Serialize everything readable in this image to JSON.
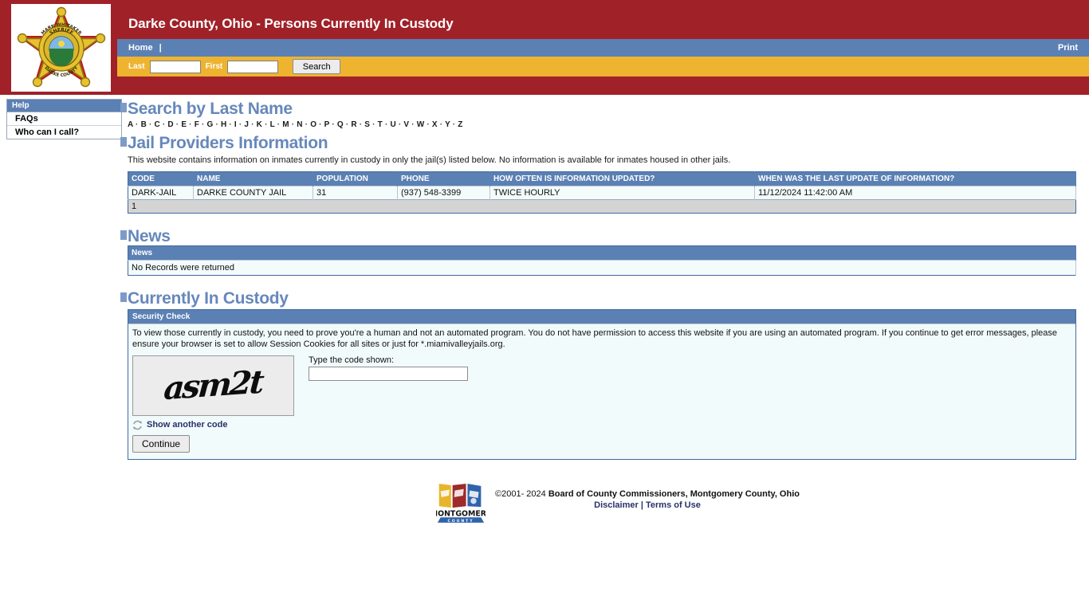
{
  "header": {
    "site_title": "Darke County, Ohio - Persons Currently In Custody",
    "logo_alt": "Mark Whitaker Sheriff Darke County badge",
    "badge_top_text": "MARK WHITAKER",
    "badge_mid_text": "SHERIFF",
    "badge_bottom_text": "DARKE COUNTY",
    "nav": {
      "home_label": "Home",
      "separator": "|",
      "print_label": "Print"
    },
    "search": {
      "last_label": "Last",
      "last_value": "",
      "last_placeholder": "",
      "first_label": "First",
      "first_value": "",
      "first_placeholder": "",
      "search_button": "Search"
    }
  },
  "sidebar": {
    "header": "Help",
    "items": [
      {
        "label": "FAQs"
      },
      {
        "label": "Who can I call?"
      }
    ]
  },
  "search_by_last_name": {
    "title": "Search by Last Name",
    "letters": [
      "A",
      "B",
      "C",
      "D",
      "E",
      "F",
      "G",
      "H",
      "I",
      "J",
      "K",
      "L",
      "M",
      "N",
      "O",
      "P",
      "Q",
      "R",
      "S",
      "T",
      "U",
      "V",
      "W",
      "X",
      "Y",
      "Z"
    ],
    "separator": "·"
  },
  "jail_providers": {
    "title": "Jail Providers Information",
    "description": "This website contains information on inmates currently in custody in only the jail(s) listed below. No information is available for inmates housed in other jails.",
    "columns": [
      "CODE",
      "NAME",
      "POPULATION",
      "PHONE",
      "HOW OFTEN IS INFORMATION UPDATED?",
      "WHEN WAS THE LAST UPDATE OF INFORMATION?"
    ],
    "rows": [
      {
        "code": "DARK-JAIL",
        "name": "DARKE COUNTY JAIL",
        "population": "31",
        "phone": "(937) 548-3399",
        "update_frequency": "TWICE HOURLY",
        "last_update": "11/12/2024 11:42:00 AM"
      }
    ],
    "page_number": "1"
  },
  "news": {
    "title": "News",
    "column": "News",
    "empty_message": "No Records were returned"
  },
  "currently_in_custody": {
    "title": "Currently In Custody",
    "security_check": {
      "panel_title": "Security Check",
      "instructions": "To view those currently in custody, you need to prove you're a human and not an automated program. You do not have permission to access this website if you are using an automated program. If you continue to get error messages, please ensure your browser is set to allow Session Cookies for all sites or just for *.miamivalleyjails.org.",
      "captcha_code": "asm2t",
      "code_label": "Type the code shown:",
      "code_value": "",
      "code_placeholder": "",
      "refresh_label": "Show another code",
      "continue_label": "Continue"
    }
  },
  "footer": {
    "copyright_symbol": "©2001- 2024",
    "owner": "Board of County Commissioners, Montgomery County, Ohio",
    "disclaimer_label": "Disclaimer",
    "separator": "|",
    "terms_label": "Terms of Use",
    "logo_text_main": "MONTGOMERY",
    "logo_text_sub": "COUNTY"
  },
  "colors": {
    "banner_red": "#a02128",
    "nav_blue": "#5b80b4",
    "search_gold": "#eeb430",
    "heading_blue": "#6688bb",
    "panel_bg": "#f2fbfb",
    "link_navy": "#27316b"
  }
}
